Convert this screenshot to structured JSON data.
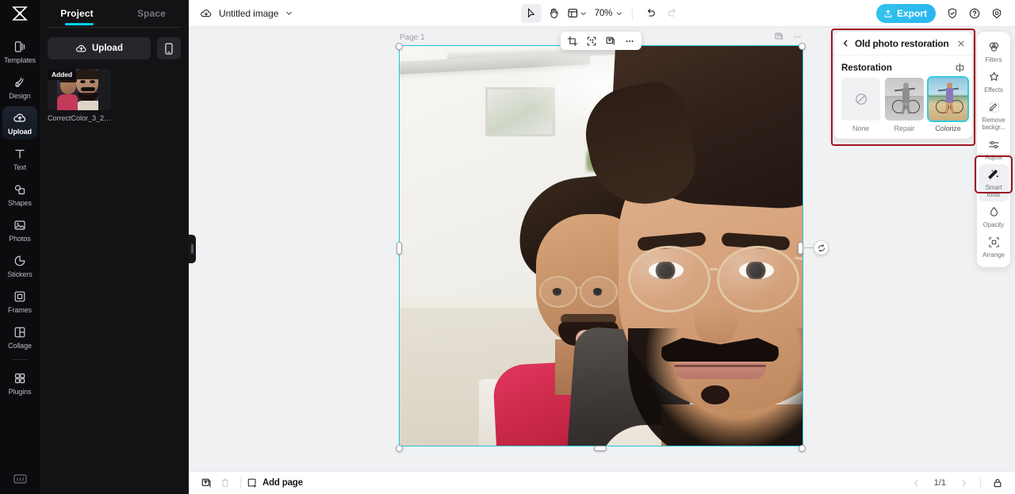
{
  "app": {
    "logo_icon": "capcut-logo-icon",
    "accent": "#00d0e1",
    "highlight": "#9e1420"
  },
  "left_panel": {
    "tabs": [
      {
        "label": "Project",
        "active": true
      },
      {
        "label": "Space",
        "active": false
      }
    ],
    "upload_button": "Upload",
    "mobile_icon": "mobile-phone-icon",
    "assets": [
      {
        "badge": "Added",
        "name": "CorrectColor_3_202..."
      }
    ]
  },
  "rail": {
    "items": [
      {
        "label": "Templates",
        "icon": "templates-icon",
        "active": false
      },
      {
        "label": "Design",
        "icon": "design-icon",
        "active": false
      },
      {
        "label": "Upload",
        "icon": "upload-cloud-icon",
        "active": true
      },
      {
        "label": "Text",
        "icon": "text-icon",
        "active": false
      },
      {
        "label": "Shapes",
        "icon": "shapes-icon",
        "active": false
      },
      {
        "label": "Photos",
        "icon": "photos-icon",
        "active": false
      },
      {
        "label": "Stickers",
        "icon": "stickers-icon",
        "active": false
      },
      {
        "label": "Frames",
        "icon": "frames-icon",
        "active": false
      },
      {
        "label": "Collage",
        "icon": "collage-icon",
        "active": false
      },
      {
        "label": "Plugins",
        "icon": "plugins-icon",
        "active": false
      }
    ],
    "bottom_icon": "keyboard-shortcuts-icon"
  },
  "topbar": {
    "cloud_icon": "cloud-save-icon",
    "document_title": "Untitled image",
    "title_chevron": "chevron-down-icon",
    "tools": [
      {
        "name": "select-tool",
        "icon": "cursor-arrow-icon",
        "selected": true
      },
      {
        "name": "hand-tool",
        "icon": "hand-icon",
        "selected": false
      },
      {
        "name": "layout-tool",
        "icon": "layout-frame-icon",
        "selected": false
      }
    ],
    "zoom_value": "70%",
    "undo_icon": "undo-icon",
    "redo_icon": "redo-icon",
    "export_label": "Export",
    "export_icon": "export-upload-icon",
    "right_icons": [
      {
        "name": "shield-check-icon"
      },
      {
        "name": "help-question-icon"
      },
      {
        "name": "settings-gear-icon"
      }
    ]
  },
  "canvas": {
    "page_label": "Page 1",
    "float_toolbar": [
      {
        "name": "crop-button",
        "icon": "crop-icon"
      },
      {
        "name": "smart-select-button",
        "icon": "ai-select-icon"
      },
      {
        "name": "duplicate-button",
        "icon": "duplicate-icon"
      },
      {
        "name": "more-button",
        "icon": "more-horizontal-icon"
      }
    ],
    "corner_icons": [
      {
        "name": "canvas-duplicate-icon"
      },
      {
        "name": "canvas-more-icon"
      }
    ],
    "rotate_handle_icon": "rotate-icon"
  },
  "property_panel": {
    "back_icon": "chevron-left-icon",
    "title": "Old photo restoration",
    "close_icon": "close-x-icon",
    "section_title": "Restoration",
    "compare_icon": "compare-split-icon",
    "options": [
      {
        "label": "None",
        "style": "none",
        "selected": false
      },
      {
        "label": "Repair",
        "style": "gray",
        "selected": false
      },
      {
        "label": "Colorize",
        "style": "color",
        "selected": true
      }
    ]
  },
  "tool_rail": {
    "items": [
      {
        "label": "Filters",
        "icon": "filters-icon",
        "active": false
      },
      {
        "label": "Effects",
        "icon": "effects-sparkle-icon",
        "active": false
      },
      {
        "label": "Remove backgr...",
        "icon": "remove-background-icon",
        "active": false
      },
      {
        "label": "Adjust",
        "icon": "adjust-sliders-icon",
        "active": false
      },
      {
        "label": "Smart tools",
        "icon": "smart-tools-wand-icon",
        "active": true
      },
      {
        "label": "Opacity",
        "icon": "opacity-drop-icon",
        "active": false
      },
      {
        "label": "Arrange",
        "icon": "arrange-icon",
        "active": false
      }
    ]
  },
  "bottombar": {
    "duplicate_icon": "duplicate-page-icon",
    "delete_icon": "trash-icon",
    "add_page_label": "Add page",
    "add_page_icon": "add-page-icon",
    "prev_icon": "chevron-left-icon",
    "page_indicator": "1/1",
    "next_icon": "chevron-right-icon",
    "lock_icon": "lock-icon"
  }
}
